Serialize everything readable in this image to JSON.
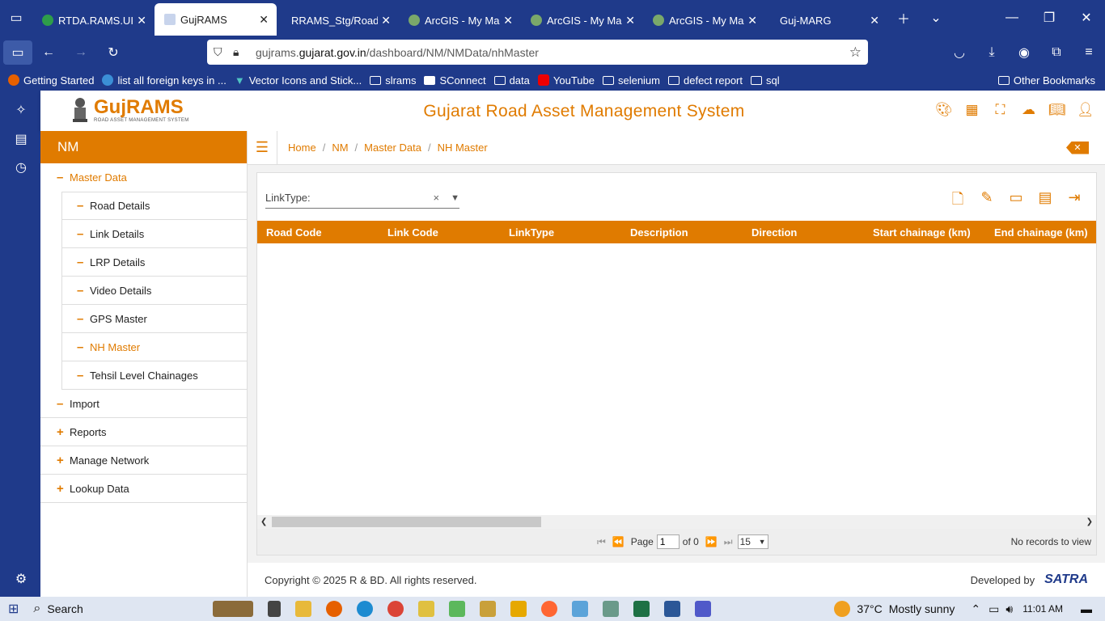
{
  "browser": {
    "tabs": [
      {
        "title": "RTDA.RAMS.UI",
        "active": false
      },
      {
        "title": "GujRAMS",
        "active": true
      },
      {
        "title": "RRAMS_Stg/RoadInve",
        "active": false
      },
      {
        "title": "ArcGIS - My Map",
        "active": false
      },
      {
        "title": "ArcGIS - My Map",
        "active": false
      },
      {
        "title": "ArcGIS - My Map",
        "active": false
      },
      {
        "title": "Guj-MARG",
        "active": false
      }
    ],
    "url_prefix": "gujrams.",
    "url_domain": "gujarat.gov.in",
    "url_path": "/dashboard/NM/NMData/nhMaster",
    "bookmarks": [
      "Getting Started",
      "list all foreign keys in ...",
      "Vector Icons and Stick...",
      "slrams",
      "SConnect",
      "data",
      "YouTube",
      "selenium",
      "defect report",
      "sql"
    ],
    "other_bookmarks": "Other Bookmarks"
  },
  "header": {
    "logo_text": "GujRAMS",
    "logo_sub": "ROAD ASSET MANAGEMENT SYSTEM",
    "title": "Gujarat Road Asset Management System",
    "icons": [
      "palette-icon",
      "grid-icon",
      "map-icon",
      "cloud-download-icon",
      "book-icon",
      "user-icon"
    ]
  },
  "leftnav": {
    "module": "NM",
    "master_data": "Master Data",
    "sub_items": [
      "Road Details",
      "Link Details",
      "LRP Details",
      "Video Details",
      "GPS Master",
      "NH Master",
      "Tehsil Level Chainages"
    ],
    "items": [
      {
        "mark": "–",
        "label": "Import"
      },
      {
        "mark": "+",
        "label": "Reports"
      },
      {
        "mark": "+",
        "label": "Manage Network"
      },
      {
        "mark": "+",
        "label": "Lookup Data"
      }
    ]
  },
  "breadcrumb": [
    "Home",
    "NM",
    "Master Data",
    "NH Master"
  ],
  "filter": {
    "label": "LinkType:",
    "clear": "×"
  },
  "grid": {
    "columns": [
      "Road Code",
      "Link Code",
      "LinkType",
      "Description",
      "Direction",
      "Start chainage (km)",
      "End chainage (km)"
    ]
  },
  "pager": {
    "page_label": "Page",
    "page_value": "1",
    "of_label": "of 0",
    "page_size": "15",
    "status": "No records to view"
  },
  "footer": {
    "copyright": "Copyright © 2025 R & BD. All rights reserved.",
    "developed_by": "Developed by",
    "brand": "SATRA"
  },
  "taskbar": {
    "search": "Search",
    "weather_temp": "37°C",
    "weather_text": "Mostly sunny",
    "time": "11:01 AM"
  },
  "colors": {
    "accent": "#e07b00",
    "browser_chrome": "#1f3a8a"
  }
}
